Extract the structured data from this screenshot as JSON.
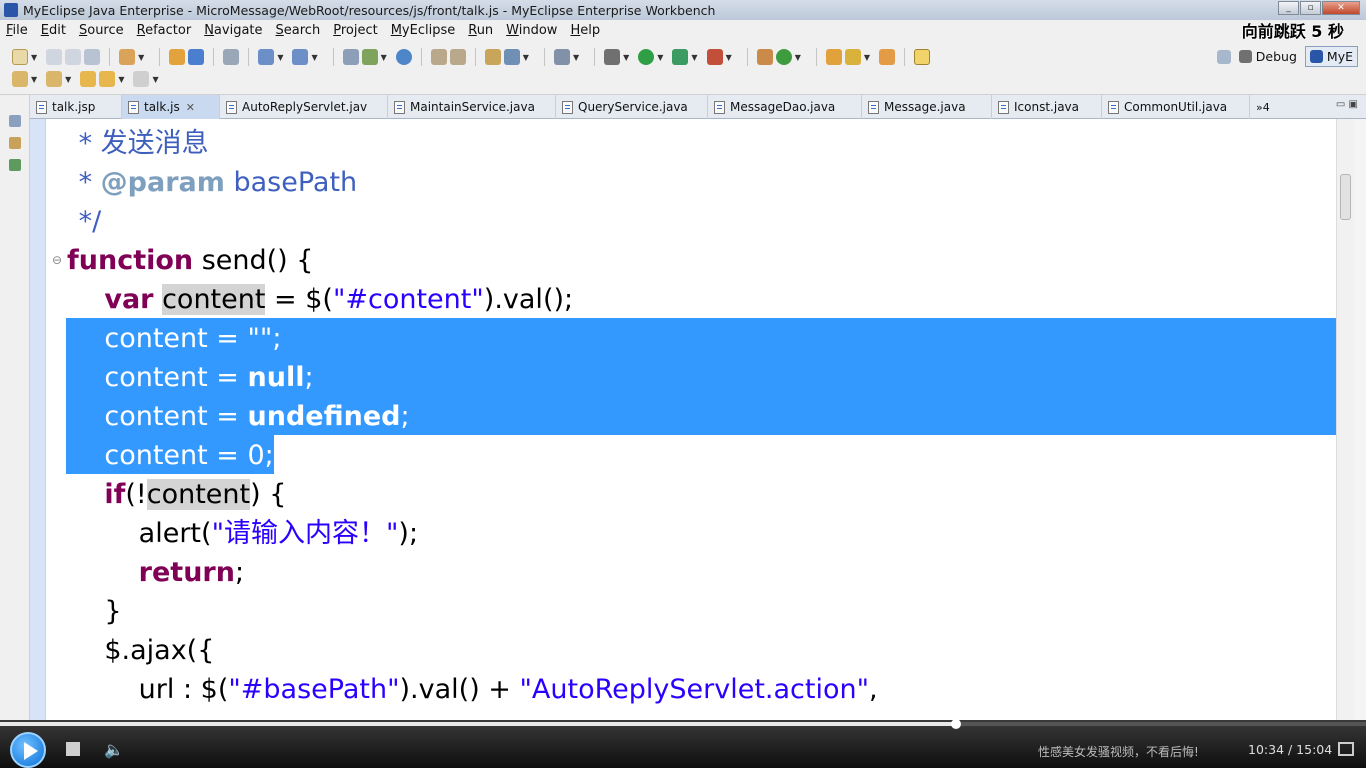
{
  "window": {
    "title": "MyEclipse Java Enterprise - MicroMessage/WebRoot/resources/js/front/talk.js - MyEclipse Enterprise Workbench"
  },
  "overlay": {
    "label": "向前跳跃 5 秒"
  },
  "menu": {
    "items": [
      "File",
      "Edit",
      "Source",
      "Refactor",
      "Navigate",
      "Search",
      "Project",
      "MyEclipse",
      "Run",
      "Window",
      "Help"
    ]
  },
  "perspectives": {
    "debug_label": "Debug",
    "myeclipse_label": "MyE"
  },
  "tabs": [
    {
      "label": "talk.jsp",
      "active": false
    },
    {
      "label": "talk.js",
      "active": true
    },
    {
      "label": "AutoReplyServlet.jav",
      "active": false
    },
    {
      "label": "MaintainService.java",
      "active": false
    },
    {
      "label": "QueryService.java",
      "active": false
    },
    {
      "label": "MessageDao.java",
      "active": false
    },
    {
      "label": "Message.java",
      "active": false
    },
    {
      "label": "Iconst.java",
      "active": false
    },
    {
      "label": "CommonUtil.java",
      "active": false
    }
  ],
  "tabs_overflow": "»4",
  "code": {
    "l1": {
      "text": " * 发送消息"
    },
    "l2": {
      "star": " * ",
      "tag": "@param",
      "rest": " basePath"
    },
    "l3": {
      "text": " */"
    },
    "l4": {
      "kw": "function",
      "rest": " send() {"
    },
    "l5": {
      "indent": "    ",
      "kw": "var",
      "sp": " ",
      "var": "content",
      "mid": " = $(",
      "str": "\"#content\"",
      "end": ").val();"
    },
    "l6": {
      "indent": "    ",
      "a": "content = ",
      "b": "\"\";"
    },
    "l7": {
      "indent": "    ",
      "a": "content = ",
      "kw": "null",
      "b": ";"
    },
    "l8": {
      "indent": "    ",
      "a": "content = ",
      "kw": "undefined",
      "b": ";"
    },
    "l9": {
      "indent": "    ",
      "a": "content = 0;"
    },
    "l10": {
      "indent": "    ",
      "kw": "if",
      "a": "(!",
      "var": "content",
      "b": ") {"
    },
    "l11": {
      "indent": "        ",
      "a": "alert(",
      "str": "\"请输入内容！\"",
      "b": ");"
    },
    "l12": {
      "indent": "        ",
      "kw": "return",
      "b": ";"
    },
    "l13": {
      "indent": "    ",
      "a": "}"
    },
    "l14": {
      "indent": "    ",
      "a": "$.ajax({"
    },
    "l15": {
      "indent": "        ",
      "a": "url : $(",
      "str1": "\"#basePath\"",
      "b": ").val() + ",
      "str2": "\"AutoReplyServlet.action\"",
      "c": ","
    }
  },
  "player": {
    "progress": 0.7,
    "promo": "性感美女发骚视频，不看后悔!",
    "time": "10:34 / 15:04"
  },
  "colors": {
    "selection": "#3399ff",
    "keyword": "#7f0055",
    "string": "#2a00ff",
    "comment": "#3f5fbf"
  }
}
